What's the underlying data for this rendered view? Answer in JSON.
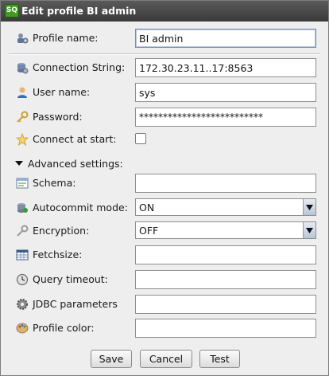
{
  "window": {
    "title": "Edit profile BI admin",
    "app_icon_text": "SQ"
  },
  "form": {
    "profile_name": {
      "label": "Profile name:",
      "value": "BI admin"
    },
    "connection_string": {
      "label": "Connection String:",
      "value": "172.30.23.11..17:8563"
    },
    "user_name": {
      "label": "User name:",
      "value": "sys"
    },
    "password": {
      "label": "Password:",
      "value": "**************************"
    },
    "connect_at_start": {
      "label": "Connect at start:",
      "checked": false
    }
  },
  "advanced": {
    "toggle_label": "Advanced settings:",
    "schema": {
      "label": "Schema:",
      "value": ""
    },
    "autocommit_mode": {
      "label": "Autocommit mode:",
      "value": "ON"
    },
    "encryption": {
      "label": "Encryption:",
      "value": "OFF"
    },
    "fetchsize": {
      "label": "Fetchsize:",
      "value": ""
    },
    "query_timeout": {
      "label": "Query timeout:",
      "value": ""
    },
    "jdbc_parameters": {
      "label": "JDBC parameters",
      "value": ""
    },
    "profile_color": {
      "label": "Profile color:",
      "value": ""
    }
  },
  "buttons": {
    "save": "Save",
    "cancel": "Cancel",
    "test": "Test"
  },
  "colors": {
    "titlebar": "#4a4a4a",
    "app_icon": "#3f9a1f",
    "window_bg": "#eeeeee"
  }
}
